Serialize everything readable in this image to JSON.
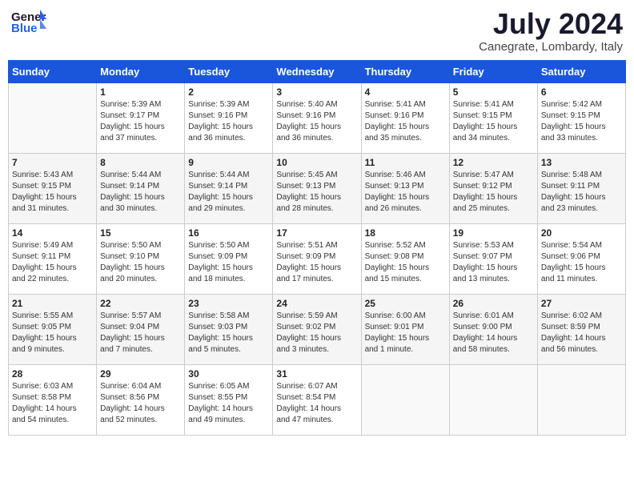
{
  "header": {
    "logo_line1": "General",
    "logo_line2": "Blue",
    "month_year": "July 2024",
    "location": "Canegrate, Lombardy, Italy"
  },
  "weekdays": [
    "Sunday",
    "Monday",
    "Tuesday",
    "Wednesday",
    "Thursday",
    "Friday",
    "Saturday"
  ],
  "weeks": [
    [
      {
        "day": "",
        "content": ""
      },
      {
        "day": "1",
        "content": "Sunrise: 5:39 AM\nSunset: 9:17 PM\nDaylight: 15 hours\nand 37 minutes."
      },
      {
        "day": "2",
        "content": "Sunrise: 5:39 AM\nSunset: 9:16 PM\nDaylight: 15 hours\nand 36 minutes."
      },
      {
        "day": "3",
        "content": "Sunrise: 5:40 AM\nSunset: 9:16 PM\nDaylight: 15 hours\nand 36 minutes."
      },
      {
        "day": "4",
        "content": "Sunrise: 5:41 AM\nSunset: 9:16 PM\nDaylight: 15 hours\nand 35 minutes."
      },
      {
        "day": "5",
        "content": "Sunrise: 5:41 AM\nSunset: 9:15 PM\nDaylight: 15 hours\nand 34 minutes."
      },
      {
        "day": "6",
        "content": "Sunrise: 5:42 AM\nSunset: 9:15 PM\nDaylight: 15 hours\nand 33 minutes."
      }
    ],
    [
      {
        "day": "7",
        "content": "Sunrise: 5:43 AM\nSunset: 9:15 PM\nDaylight: 15 hours\nand 31 minutes."
      },
      {
        "day": "8",
        "content": "Sunrise: 5:44 AM\nSunset: 9:14 PM\nDaylight: 15 hours\nand 30 minutes."
      },
      {
        "day": "9",
        "content": "Sunrise: 5:44 AM\nSunset: 9:14 PM\nDaylight: 15 hours\nand 29 minutes."
      },
      {
        "day": "10",
        "content": "Sunrise: 5:45 AM\nSunset: 9:13 PM\nDaylight: 15 hours\nand 28 minutes."
      },
      {
        "day": "11",
        "content": "Sunrise: 5:46 AM\nSunset: 9:13 PM\nDaylight: 15 hours\nand 26 minutes."
      },
      {
        "day": "12",
        "content": "Sunrise: 5:47 AM\nSunset: 9:12 PM\nDaylight: 15 hours\nand 25 minutes."
      },
      {
        "day": "13",
        "content": "Sunrise: 5:48 AM\nSunset: 9:11 PM\nDaylight: 15 hours\nand 23 minutes."
      }
    ],
    [
      {
        "day": "14",
        "content": "Sunrise: 5:49 AM\nSunset: 9:11 PM\nDaylight: 15 hours\nand 22 minutes."
      },
      {
        "day": "15",
        "content": "Sunrise: 5:50 AM\nSunset: 9:10 PM\nDaylight: 15 hours\nand 20 minutes."
      },
      {
        "day": "16",
        "content": "Sunrise: 5:50 AM\nSunset: 9:09 PM\nDaylight: 15 hours\nand 18 minutes."
      },
      {
        "day": "17",
        "content": "Sunrise: 5:51 AM\nSunset: 9:09 PM\nDaylight: 15 hours\nand 17 minutes."
      },
      {
        "day": "18",
        "content": "Sunrise: 5:52 AM\nSunset: 9:08 PM\nDaylight: 15 hours\nand 15 minutes."
      },
      {
        "day": "19",
        "content": "Sunrise: 5:53 AM\nSunset: 9:07 PM\nDaylight: 15 hours\nand 13 minutes."
      },
      {
        "day": "20",
        "content": "Sunrise: 5:54 AM\nSunset: 9:06 PM\nDaylight: 15 hours\nand 11 minutes."
      }
    ],
    [
      {
        "day": "21",
        "content": "Sunrise: 5:55 AM\nSunset: 9:05 PM\nDaylight: 15 hours\nand 9 minutes."
      },
      {
        "day": "22",
        "content": "Sunrise: 5:57 AM\nSunset: 9:04 PM\nDaylight: 15 hours\nand 7 minutes."
      },
      {
        "day": "23",
        "content": "Sunrise: 5:58 AM\nSunset: 9:03 PM\nDaylight: 15 hours\nand 5 minutes."
      },
      {
        "day": "24",
        "content": "Sunrise: 5:59 AM\nSunset: 9:02 PM\nDaylight: 15 hours\nand 3 minutes."
      },
      {
        "day": "25",
        "content": "Sunrise: 6:00 AM\nSunset: 9:01 PM\nDaylight: 15 hours\nand 1 minute."
      },
      {
        "day": "26",
        "content": "Sunrise: 6:01 AM\nSunset: 9:00 PM\nDaylight: 14 hours\nand 58 minutes."
      },
      {
        "day": "27",
        "content": "Sunrise: 6:02 AM\nSunset: 8:59 PM\nDaylight: 14 hours\nand 56 minutes."
      }
    ],
    [
      {
        "day": "28",
        "content": "Sunrise: 6:03 AM\nSunset: 8:58 PM\nDaylight: 14 hours\nand 54 minutes."
      },
      {
        "day": "29",
        "content": "Sunrise: 6:04 AM\nSunset: 8:56 PM\nDaylight: 14 hours\nand 52 minutes."
      },
      {
        "day": "30",
        "content": "Sunrise: 6:05 AM\nSunset: 8:55 PM\nDaylight: 14 hours\nand 49 minutes."
      },
      {
        "day": "31",
        "content": "Sunrise: 6:07 AM\nSunset: 8:54 PM\nDaylight: 14 hours\nand 47 minutes."
      },
      {
        "day": "",
        "content": ""
      },
      {
        "day": "",
        "content": ""
      },
      {
        "day": "",
        "content": ""
      }
    ]
  ]
}
